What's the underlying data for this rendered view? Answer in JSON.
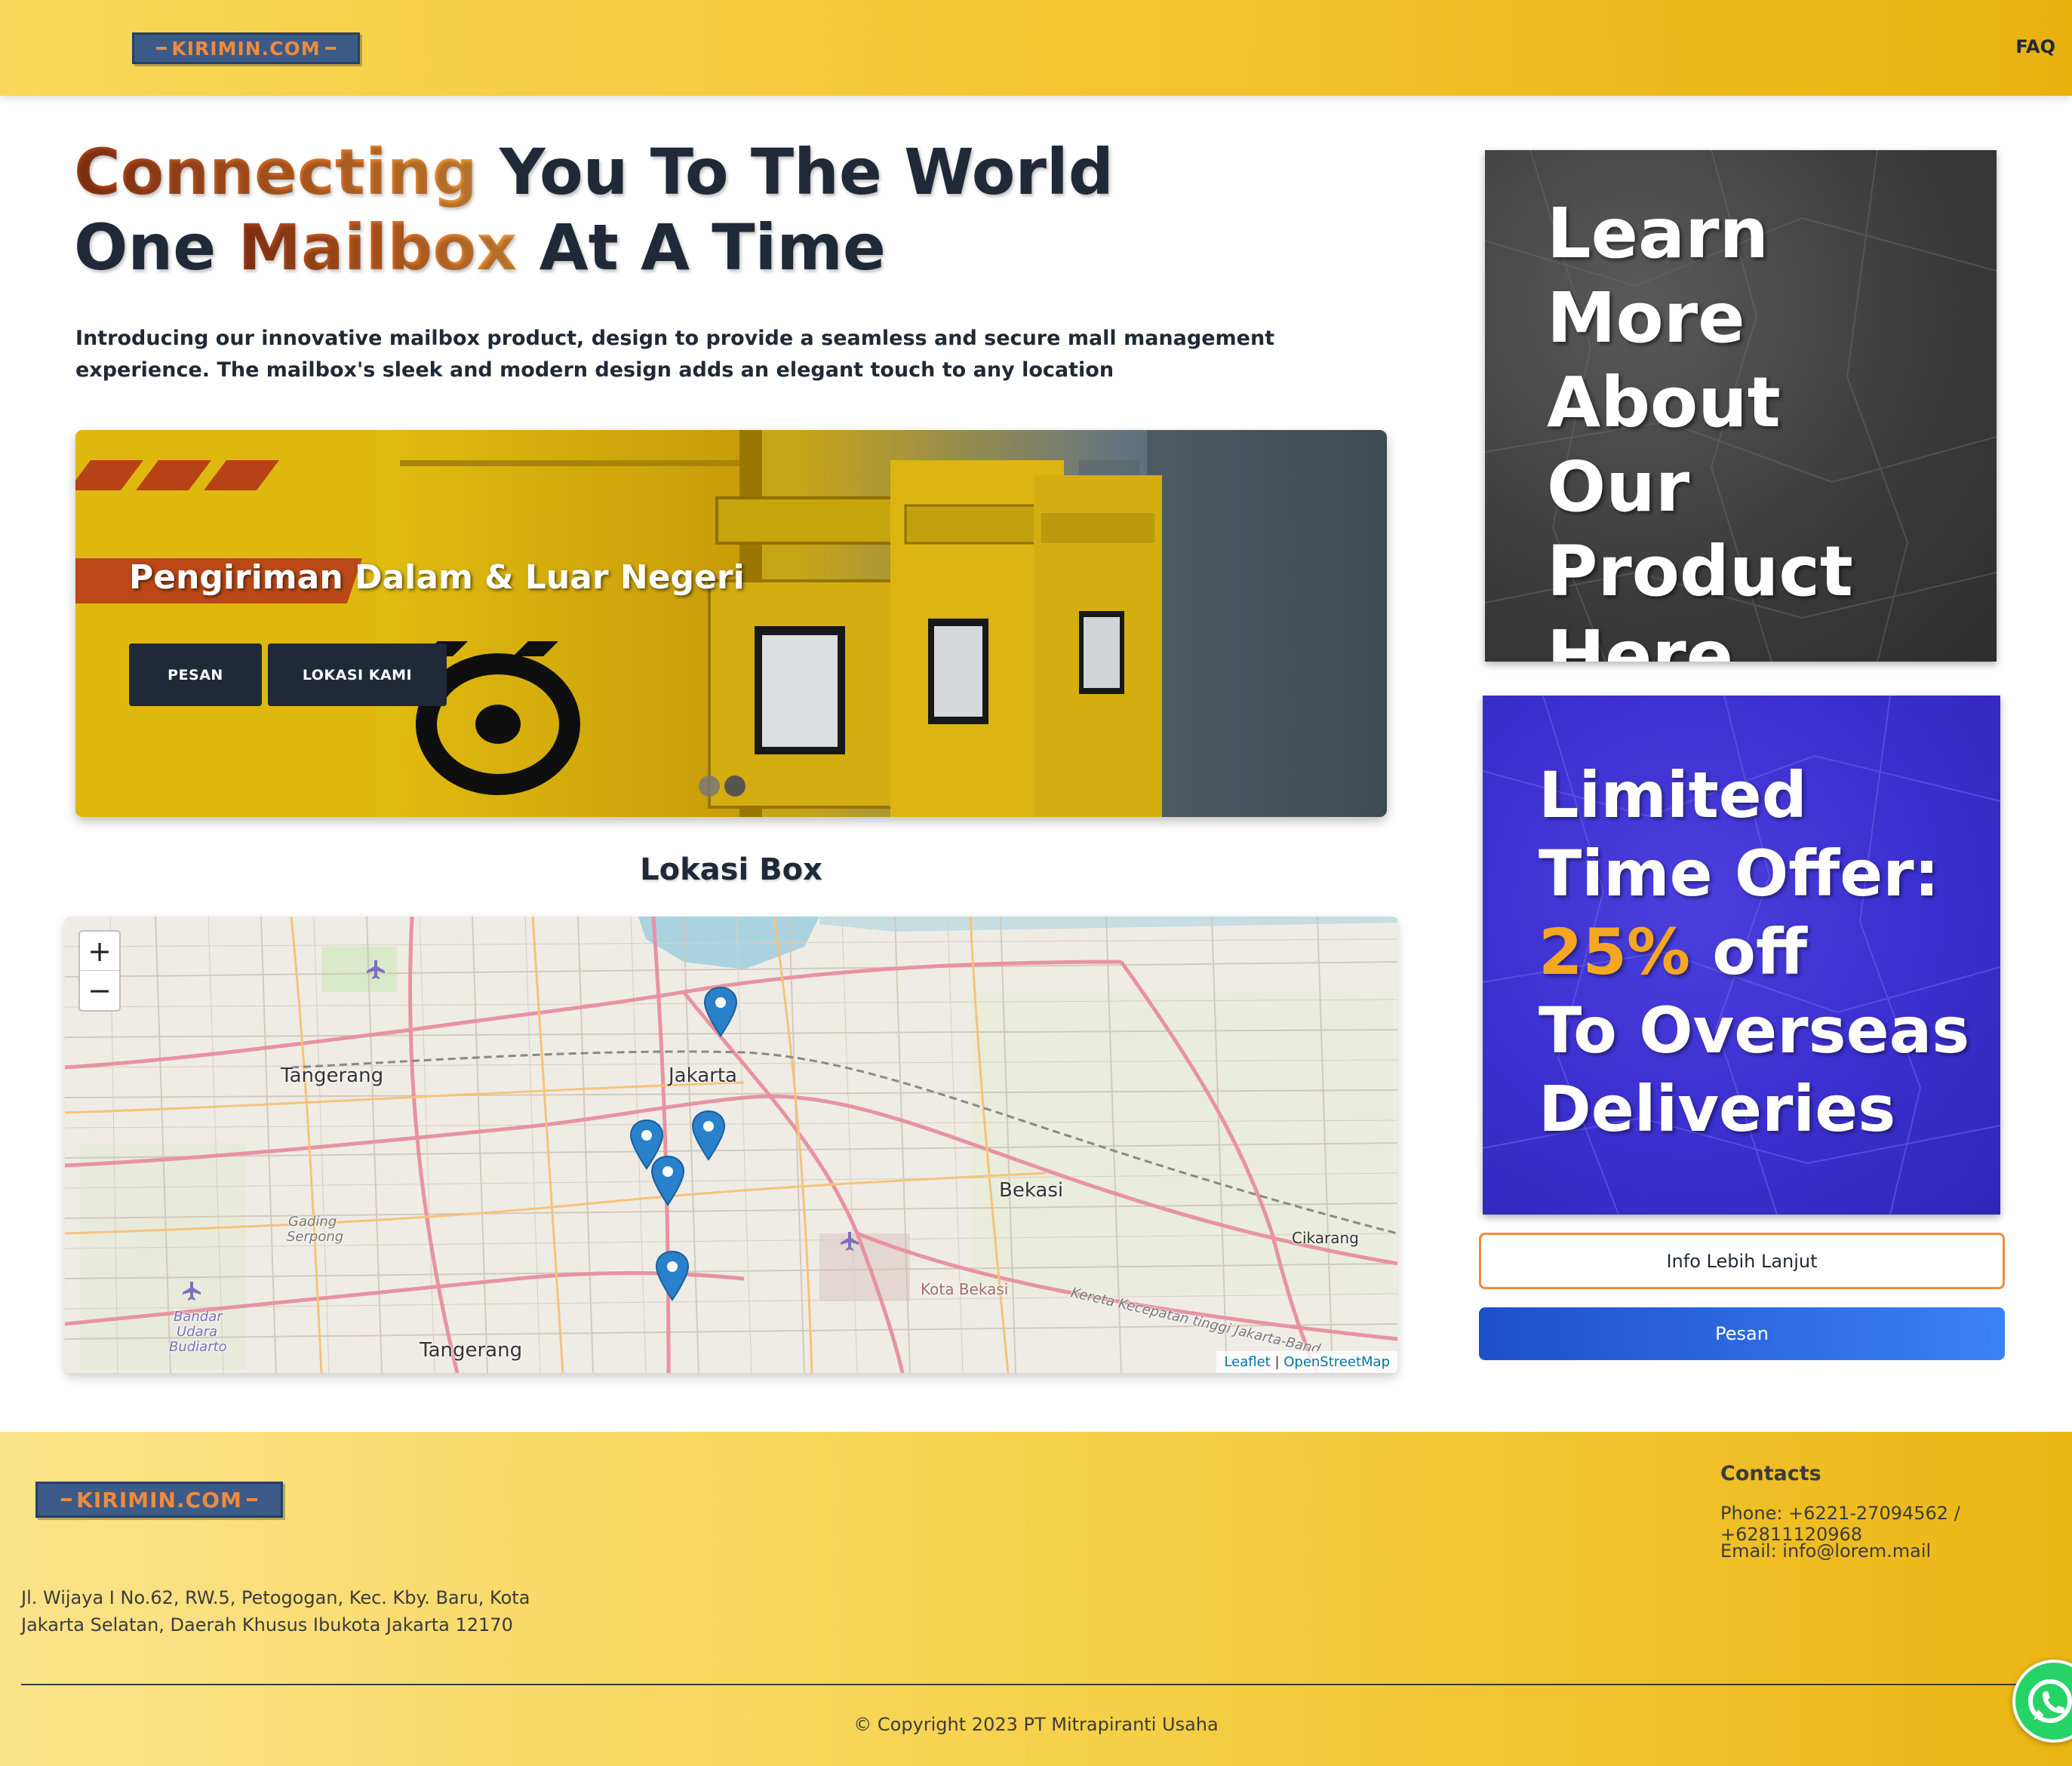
{
  "header": {
    "logo_text": "KIRIMIN.COM",
    "faq_label": "FAQ"
  },
  "hero": {
    "title_line1_accent": "Connecting",
    "title_line1_rest": " You To The World",
    "title_line2_start": "One ",
    "title_line2_accent": "Mailbox",
    "title_line2_rest": " At A Time",
    "description": "Introducing our innovative mailbox product, design to provide a seamless and secure mall management experience. The mailbox's sleek and modern design adds an elegant touch to any location"
  },
  "carousel": {
    "caption": "Pengiriman Dalam & Luar Negeri",
    "order_button": "PESAN",
    "location_button": "LOKASI KAMI",
    "slide_count": 2,
    "active_slide": 2
  },
  "map": {
    "title": "Lokasi Box",
    "zoom_in": "+",
    "zoom_out": "−",
    "attribution_leaflet": "Leaflet",
    "attribution_sep": " | ",
    "attribution_osm": "OpenStreetMap",
    "places": {
      "tangerang_north": "Tangerang",
      "jakarta": "Jakarta",
      "bekasi": "Bekasi",
      "cikarang": "Cikarang",
      "kota_bekasi": "Kota Bekasi",
      "tangerang_south": "Tangerang",
      "gading_serpong_1": "Gading",
      "gading_serpong_2": "Serpong",
      "airport_1": "Bandar",
      "airport_2": "Udara",
      "airport_3": "Budiarto",
      "toll_road": "Kereta Kecepatan tinggi Jakarta-Band"
    },
    "marker_count": 5
  },
  "promo": {
    "learn_more_lines": [
      "Learn",
      "More About",
      "Our",
      "Product",
      "Here"
    ],
    "offer_line1": "Limited",
    "offer_line2": "Time Offer:",
    "offer_percent": "25%",
    "offer_off": " off",
    "offer_line4": "To Overseas",
    "offer_line5": "Deliveries",
    "info_button": "Info Lebih Lanjut",
    "order_button": "Pesan"
  },
  "footer": {
    "logo_text": "KIRIMIN.COM",
    "address_line1": "Jl. Wijaya I No.62, RW.5, Petogogan, Kec. Kby. Baru, Kota",
    "address_line2": "Jakarta Selatan, Daerah Khusus Ibukota Jakarta 12170",
    "contacts_title": "Contacts",
    "phone": "Phone: +6221-27094562 / +62811120968",
    "email": "Email: info@lorem.mail",
    "copyright": "© Copyright 2023 PT Mitrapiranti Usaha"
  },
  "colors": {
    "header_yellow": "#f3c52f",
    "accent_orange": "#e0742a",
    "dark_navy": "#1f2937",
    "promo_purple": "#3a2fcf",
    "order_blue": "#2563eb",
    "whatsapp_green": "#25d366"
  },
  "icons": {
    "whatsapp": "whatsapp-icon",
    "map_marker": "map-marker-icon",
    "airport": "airplane-icon"
  }
}
